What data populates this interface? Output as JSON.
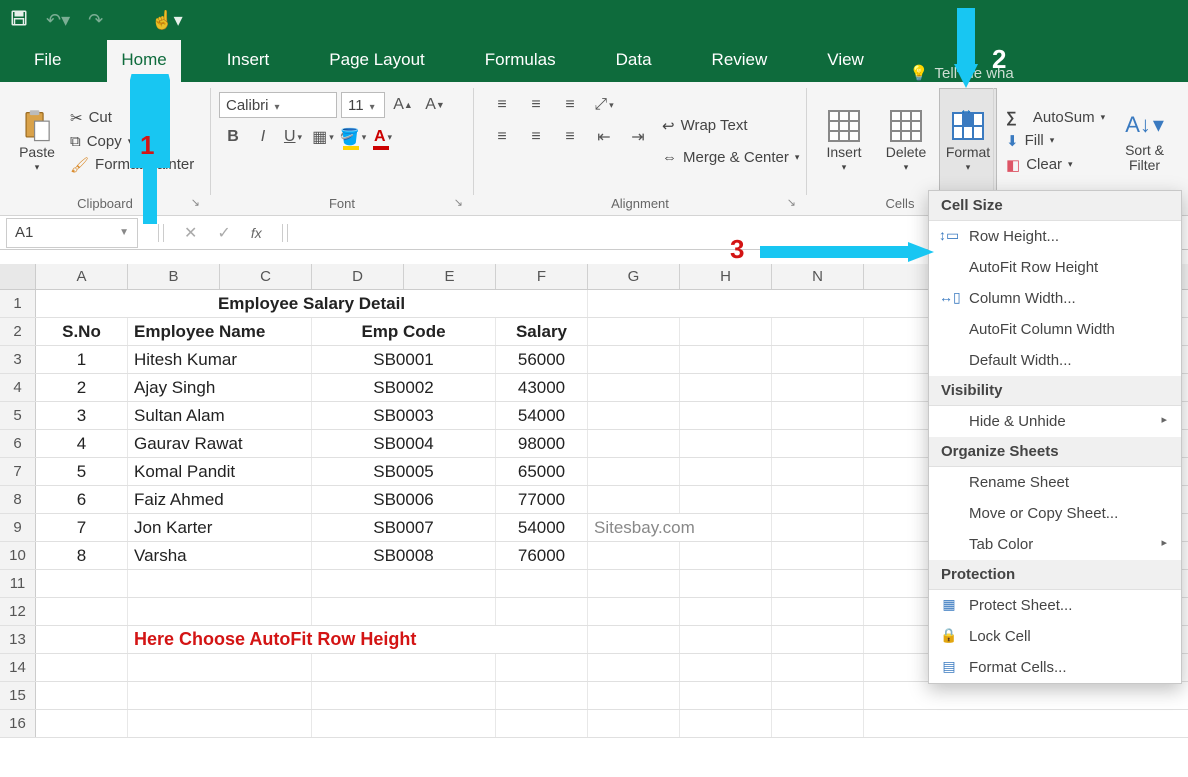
{
  "qat": {
    "save": "💾",
    "undo": "↶",
    "redo": "↷",
    "touch": "☝"
  },
  "tabs": {
    "file": "File",
    "home": "Home",
    "insert": "Insert",
    "page_layout": "Page Layout",
    "formulas": "Formulas",
    "data": "Data",
    "review": "Review",
    "view": "View",
    "tell_me": "Tell me wha"
  },
  "ribbon": {
    "clipboard": {
      "paste": "Paste",
      "cut": "Cut",
      "copy": "Copy",
      "format_painter": "Format Painter",
      "label": "Clipboard"
    },
    "font": {
      "name": "Calibri",
      "size": "11",
      "label": "Font"
    },
    "alignment": {
      "wrap": "Wrap Text",
      "merge": "Merge & Center",
      "label": "Alignment"
    },
    "cells": {
      "insert": "Insert",
      "delete": "Delete",
      "format": "Format",
      "label": "Cells"
    },
    "editing": {
      "autosum": "AutoSum",
      "fill": "Fill",
      "clear": "Clear",
      "sort": "Sort & Filter"
    }
  },
  "namebox": {
    "ref": "A1"
  },
  "columns": [
    "A",
    "B",
    "C",
    "D",
    "E",
    "F",
    "G",
    "H",
    "N"
  ],
  "title_row": "Employee Salary Detail",
  "headers": {
    "sno": "S.No",
    "name": "Employee Name",
    "code": "Emp Code",
    "salary": "Salary"
  },
  "rows": [
    {
      "sno": "1",
      "name": "Hitesh Kumar",
      "code": "SB0001",
      "salary": "56000"
    },
    {
      "sno": "2",
      "name": "Ajay Singh",
      "code": "SB0002",
      "salary": "43000"
    },
    {
      "sno": "3",
      "name": "Sultan Alam",
      "code": "SB0003",
      "salary": "54000"
    },
    {
      "sno": "4",
      "name": "Gaurav Rawat",
      "code": "SB0004",
      "salary": "98000"
    },
    {
      "sno": "5",
      "name": "Komal Pandit",
      "code": "SB0005",
      "salary": "65000"
    },
    {
      "sno": "6",
      "name": "Faiz Ahmed",
      "code": "SB0006",
      "salary": "77000"
    },
    {
      "sno": "7",
      "name": "Jon Karter",
      "code": "SB0007",
      "salary": "54000"
    },
    {
      "sno": "8",
      "name": "Varsha",
      "code": "SB0008",
      "salary": "76000"
    }
  ],
  "watermark": "Sitesbay.com",
  "note": "Here Choose AutoFit Row Height",
  "format_menu": {
    "sec1": "Cell Size",
    "row_height": "Row Height...",
    "autofit_row": "AutoFit Row Height",
    "col_width": "Column Width...",
    "autofit_col": "AutoFit Column Width",
    "def_width": "Default Width...",
    "sec2": "Visibility",
    "hide": "Hide & Unhide",
    "sec3": "Organize Sheets",
    "rename": "Rename Sheet",
    "move": "Move or Copy Sheet...",
    "tab_color": "Tab Color",
    "sec4": "Protection",
    "protect": "Protect Sheet...",
    "lock": "Lock Cell",
    "format_cells": "Format Cells..."
  },
  "annotations": {
    "n1": "1",
    "n2": "2",
    "n3": "3"
  }
}
